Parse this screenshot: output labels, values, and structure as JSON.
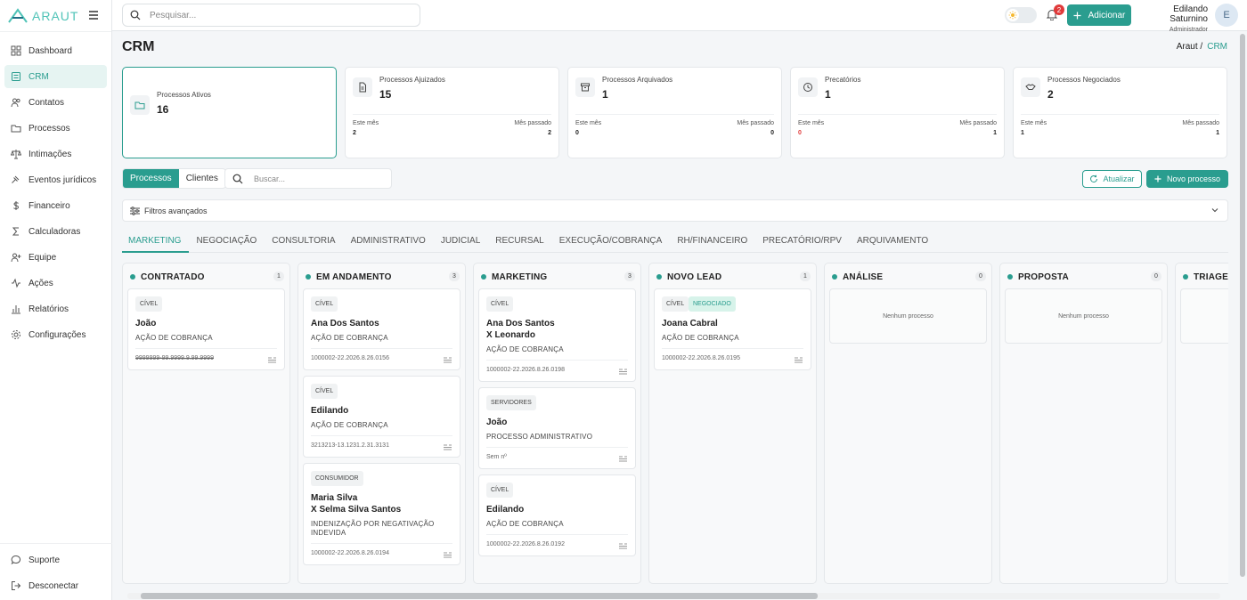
{
  "brand": {
    "name": "ARAUT"
  },
  "colors": {
    "accent": "#2a9d8f",
    "danger": "#e03a3a"
  },
  "topbar": {
    "search_placeholder": "Pesquisar...",
    "notifications_count": "2",
    "add_label": "Adicionar",
    "user_name": "Edilando Saturnino",
    "user_role": "Administrador",
    "avatar_initial": "E"
  },
  "sidebar": {
    "items": [
      {
        "label": "Dashboard",
        "icon": "grid-icon"
      },
      {
        "label": "CRM",
        "icon": "crm-icon",
        "active": true
      },
      {
        "label": "Contatos",
        "icon": "users-icon"
      },
      {
        "label": "Processos",
        "icon": "folder-icon"
      },
      {
        "label": "Intimações",
        "icon": "scale-icon"
      },
      {
        "label": "Eventos jurídicos",
        "icon": "gavel-icon"
      },
      {
        "label": "Financeiro",
        "icon": "dollar-icon"
      },
      {
        "label": "Calculadoras",
        "icon": "sigma-icon"
      },
      {
        "label": "Equipe",
        "icon": "user-plus-icon"
      },
      {
        "label": "Ações",
        "icon": "activity-icon"
      },
      {
        "label": "Relatórios",
        "icon": "bar-chart-icon"
      },
      {
        "label": "Configurações",
        "icon": "gear-icon"
      }
    ],
    "bottom": [
      {
        "label": "Suporte",
        "icon": "chat-icon"
      },
      {
        "label": "Desconectar",
        "icon": "logout-icon"
      }
    ]
  },
  "page": {
    "title": "CRM",
    "breadcrumb_root": "Araut /",
    "breadcrumb_current": "CRM"
  },
  "stats": [
    {
      "label": "Processos Ativos",
      "value": "16"
    },
    {
      "label": "Processos Ajuizados",
      "value": "15",
      "this_month_label": "Este mês",
      "last_month_label": "Mês passado",
      "this_month": "2",
      "last_month": "2"
    },
    {
      "label": "Processos Arquivados",
      "value": "1",
      "this_month_label": "Este mês",
      "last_month_label": "Mês passado",
      "this_month": "0",
      "last_month": "0"
    },
    {
      "label": "Precatórios",
      "value": "1",
      "this_month_label": "Este mês",
      "last_month_label": "Mês passado",
      "this_month": "0",
      "last_month": "1"
    },
    {
      "label": "Processos Negociados",
      "value": "2",
      "this_month_label": "Este mês",
      "last_month_label": "Mês passado",
      "this_month": "1",
      "last_month": "1"
    }
  ],
  "controls": {
    "segment": [
      "Processos",
      "Clientes"
    ],
    "search_placeholder": "Buscar...",
    "refresh_label": "Atualizar",
    "new_label": "Novo processo",
    "filters_label": "Filtros avançados"
  },
  "tabs": [
    "MARKETING",
    "NEGOCIAÇÃO",
    "CONSULTORIA",
    "ADMINISTRATIVO",
    "JUDICIAL",
    "RECURSAL",
    "EXECUÇÃO/COBRANÇA",
    "RH/FINANCEIRO",
    "PRECATÓRIO/RPV",
    "ARQUIVAMENTO"
  ],
  "board": {
    "empty_text": "Nenhum processo",
    "columns": [
      {
        "title": "CONTRATADO",
        "count": "1",
        "cards": [
          {
            "tag": "CÍVEL",
            "name": [
              "João"
            ],
            "type": [
              "AÇÃO DE COBRANÇA"
            ],
            "number": "9999999-99.9999.9.99.9999"
          }
        ]
      },
      {
        "title": "EM ANDAMENTO",
        "count": "3",
        "cards": [
          {
            "tag": "CÍVEL",
            "name": [
              "Ana Dos Santos"
            ],
            "type": [
              "AÇÃO DE COBRANÇA"
            ],
            "number": "1000002-22.2026.8.26.0156"
          },
          {
            "tag": "CÍVEL",
            "name": [
              "Edilando"
            ],
            "type": [
              "AÇÃO DE COBRANÇA"
            ],
            "number": "3213213-13.1231.2.31.3131"
          },
          {
            "tag": "CONSUMIDOR",
            "name": [
              "Maria Silva",
              "X Selma Silva Santos"
            ],
            "type": [
              "INDENIZAÇÃO POR NEGATIVAÇÃO",
              "INDEVIDA"
            ],
            "number": "1000002-22.2026.8.26.0194"
          }
        ]
      },
      {
        "title": "MARKETING",
        "count": "3",
        "cards": [
          {
            "tag": "CÍVEL",
            "name": [
              "Ana Dos Santos",
              "X Leonardo"
            ],
            "type": [
              "AÇÃO DE COBRANÇA"
            ],
            "number": "1000002-22.2026.8.26.0198"
          },
          {
            "tag": "SERVIDORES",
            "name": [
              "João"
            ],
            "type": [
              "PROCESSO ADMINISTRATIVO"
            ],
            "number": "Sem nº"
          },
          {
            "tag": "CÍVEL",
            "name": [
              "Edilando"
            ],
            "type": [
              "AÇÃO DE COBRANÇA"
            ],
            "number": "1000002-22.2026.8.26.0192"
          }
        ]
      },
      {
        "title": "NOVO LEAD",
        "count": "1",
        "cards": [
          {
            "tag": "CÍVEL",
            "tag2": "NEGOCIADO",
            "name": [
              "Joana Cabral"
            ],
            "type": [
              "AÇÃO DE COBRANÇA"
            ],
            "number": "1000002-22.2026.8.26.0195"
          }
        ]
      },
      {
        "title": "ANÁLISE",
        "count": "0",
        "cards": []
      },
      {
        "title": "PROPOSTA",
        "count": "0",
        "cards": []
      },
      {
        "title": "TRIAGEM",
        "count": "",
        "cards": []
      }
    ]
  }
}
